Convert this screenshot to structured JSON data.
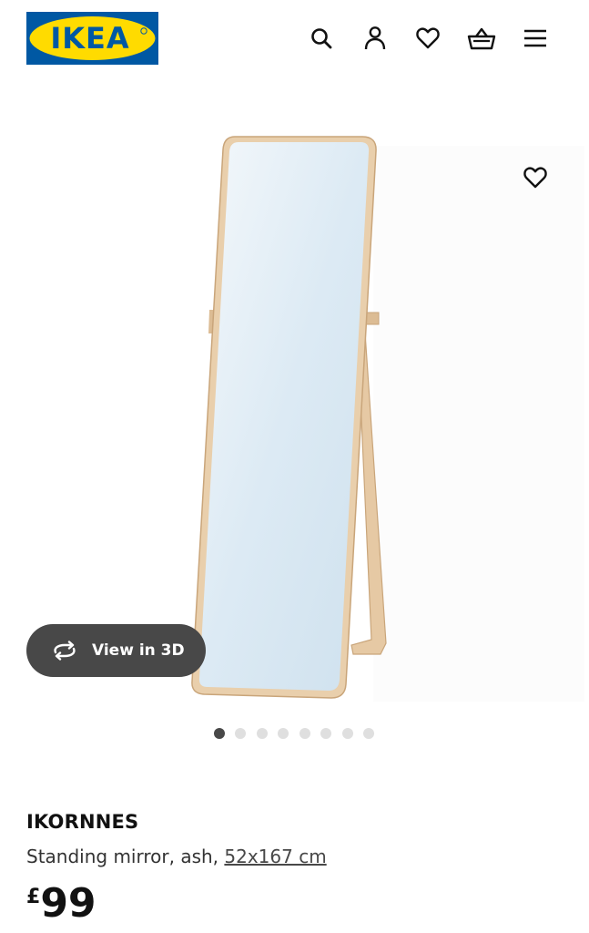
{
  "brand": {
    "logo_text": "IKEA",
    "colors": {
      "blue": "#0058a3",
      "yellow": "#ffdb00"
    }
  },
  "header": {
    "icons": [
      "search-icon",
      "account-icon",
      "heart-icon",
      "basket-icon",
      "menu-icon"
    ]
  },
  "gallery": {
    "view_3d_label": "View in 3D",
    "slide_count": 8,
    "active_slide": 1
  },
  "product": {
    "name": "IKORNNES",
    "description": "Standing mirror, ash,",
    "measurement": "52x167 cm",
    "currency": "£",
    "price": "99"
  }
}
